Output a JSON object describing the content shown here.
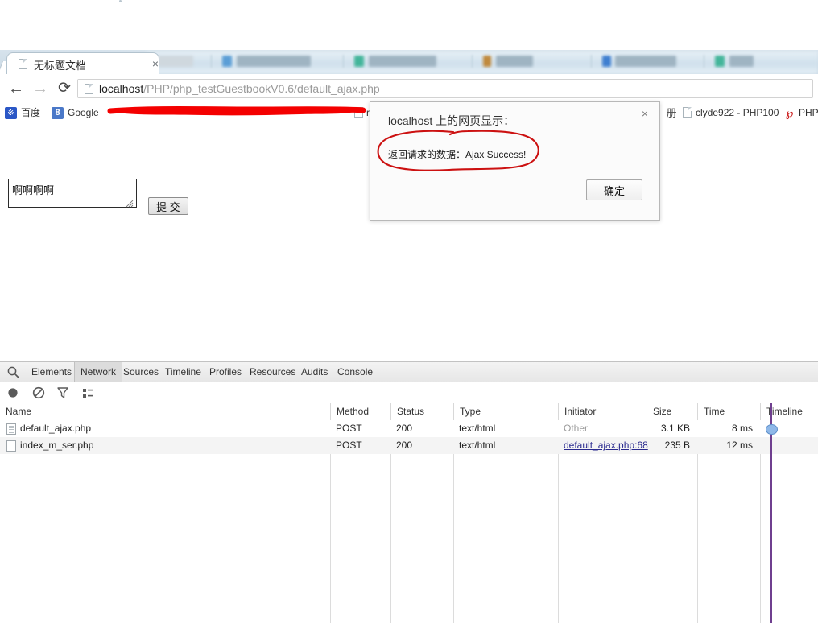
{
  "browser": {
    "tab": {
      "title": "无标题文档",
      "close_label": "×",
      "favicon": "document-icon"
    },
    "nav": {
      "back": "←",
      "forward": "→",
      "reload": "⟳"
    },
    "omnibox": {
      "url_host": "localhost",
      "url_path": "/PHP/php_testGuestbookV0.6/default_ajax.php",
      "full_url": "localhost/PHP/php_testGuestbookV0.6/default_ajax.php"
    },
    "bookmarks": [
      {
        "label": "百度",
        "icon": "baidu-icon",
        "icon_glyph": "※"
      },
      {
        "label": "Google",
        "icon": "google-icon",
        "icon_glyph": "8"
      },
      {
        "label": "ra",
        "icon": "page-icon"
      },
      {
        "label": "clyde922 - PHP100",
        "icon": "page-icon"
      },
      {
        "label": "PHP",
        "icon": "php-icon",
        "icon_glyph": "℘"
      }
    ],
    "bookmarks_menu_glyph": "册"
  },
  "page": {
    "textarea_value": "啊啊啊啊",
    "textarea_placeholder": "",
    "submit_label": "提 交"
  },
  "dialog": {
    "title": "localhost 上的网页显示：",
    "message": "返回请求的数据：Ajax Success!",
    "ok_label": "确定",
    "close_label": "×"
  },
  "devtools": {
    "tabs": [
      {
        "label": "Elements",
        "active": false
      },
      {
        "label": "Network",
        "active": true
      },
      {
        "label": "Sources",
        "active": false
      },
      {
        "label": "Timeline",
        "active": false
      },
      {
        "label": "Profiles",
        "active": false
      },
      {
        "label": "Resources",
        "active": false
      },
      {
        "label": "Audits",
        "active": false
      },
      {
        "label": "Console",
        "active": false
      }
    ],
    "toolbar": [
      {
        "name": "record-button",
        "icon": "record-circle-icon"
      },
      {
        "name": "clear-button",
        "icon": "no-entry-icon"
      },
      {
        "name": "filter-button",
        "icon": "funnel-icon"
      },
      {
        "name": "view-list-button",
        "icon": "list-view-icon"
      }
    ],
    "columns": [
      "Name",
      "Method",
      "Status",
      "Type",
      "Initiator",
      "Size",
      "Time",
      "Timeline"
    ],
    "rows": [
      {
        "name": "default_ajax.php",
        "method": "POST",
        "status": "200",
        "type": "text/html",
        "initiator": "Other",
        "initiator_link": false,
        "size": "3.1 KB",
        "time": "8 ms"
      },
      {
        "name": "index_m_ser.php",
        "method": "POST",
        "status": "200",
        "type": "text/html",
        "initiator": "default_ajax.php:68",
        "initiator_link": true,
        "size": "235 B",
        "time": "12 ms"
      }
    ]
  },
  "annotations": {
    "redaction_color": "#f40000",
    "circle_color": "#cc1111"
  }
}
